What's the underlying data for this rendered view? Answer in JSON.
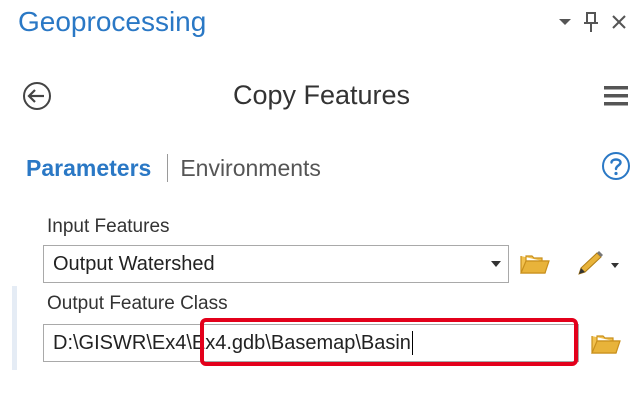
{
  "pane": {
    "title": "Geoprocessing"
  },
  "pane_controls": [
    {
      "name": "dropdown-arrow-icon"
    },
    {
      "name": "pin-icon"
    },
    {
      "name": "close-icon"
    }
  ],
  "tool": {
    "title": "Copy Features"
  },
  "tabs": {
    "parameters": "Parameters",
    "environments": "Environments"
  },
  "params": {
    "input_label": "Input Features",
    "input_value": "Output Watershed",
    "output_label": "Output Feature Class",
    "output_value": "D:\\GISWR\\Ex4\\Ex4.gdb\\Basemap\\Basin"
  },
  "icons": {
    "back": "back-arrow-icon",
    "menu": "hamburger-menu-icon",
    "help": "help-icon",
    "folder": "folder-icon",
    "pencil": "pencil-icon"
  },
  "colors": {
    "accent": "#2a78c5",
    "folder": "#e8b33a",
    "highlight": "#e3001b"
  }
}
